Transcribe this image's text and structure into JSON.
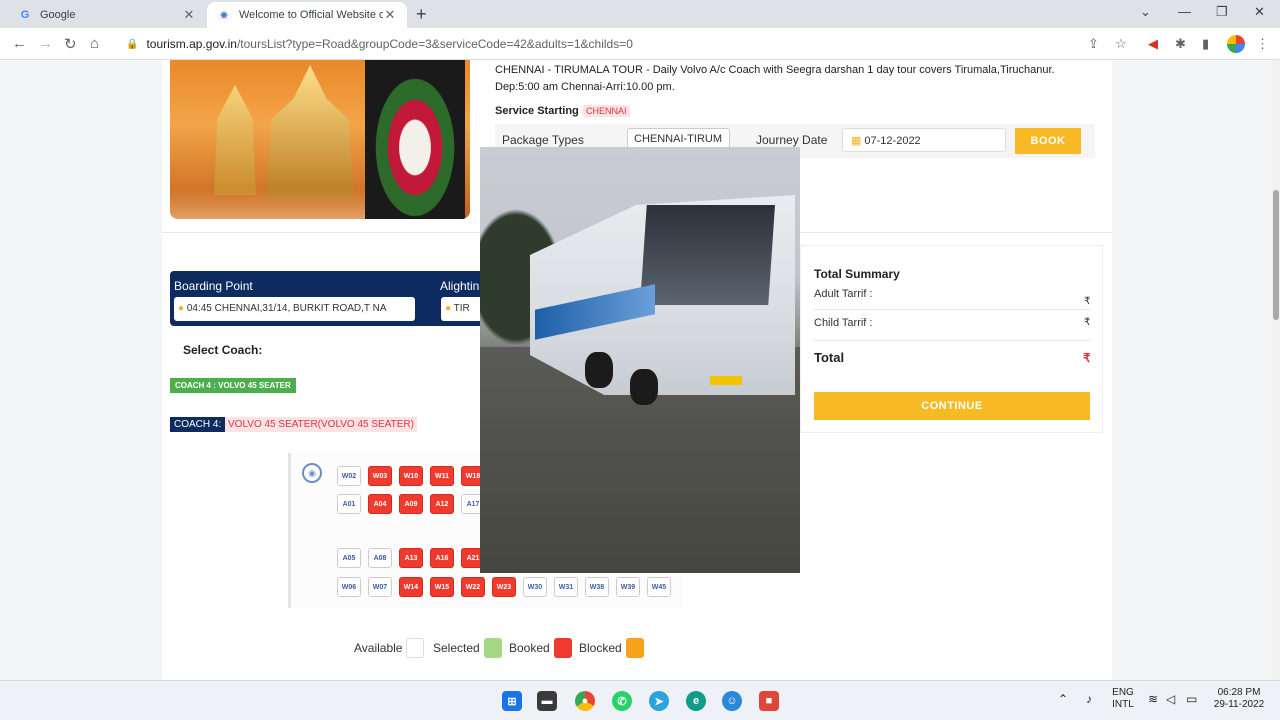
{
  "browser": {
    "tabs": [
      {
        "title": "Google",
        "icon": "google-g-icon"
      },
      {
        "title": "Welcome to Official Website of A",
        "icon": "ap-tourism-icon"
      }
    ],
    "url_host": "tourism.ap.gov.in",
    "url_path": "/toursList?type=Road&groupCode=3&serviceCode=42&adults=1&childs=0"
  },
  "tour": {
    "description": "CHENNAI - TIRUMALA TOUR - Daily Volvo A/c Coach with Seegra darshan 1 day tour covers Tirumala,Tiruchanur. Dep:5:00 am Chennai-Arri:10.00 pm.",
    "service_label": "Service Starting :",
    "service_value": "CHENNAI",
    "package_label": "Package Types",
    "package_value": "CHENNAI-TIRUM",
    "journey_label": "Journey Date",
    "journey_value": "07-12-2022",
    "book_label": "BOOK"
  },
  "boarding": {
    "boarding_label": "Boarding Point",
    "boarding_value": "04:45 CHENNAI,31/14, BURKIT ROAD,T NA",
    "alighting_label": "Alightin",
    "alighting_value": "TIR"
  },
  "coach": {
    "select_label": "Select Coach:",
    "chip": "COACH 4 : VOLVO 45 SEATER",
    "tag": "COACH 4:",
    "type": "VOLVO 45 SEATER(VOLVO 45 SEATER)"
  },
  "seats": {
    "row1": [
      {
        "id": "W02",
        "status": "available"
      },
      {
        "id": "W03",
        "status": "booked"
      },
      {
        "id": "W10",
        "status": "booked"
      },
      {
        "id": "W11",
        "status": "booked"
      },
      {
        "id": "W18",
        "status": "booked"
      }
    ],
    "row2": [
      {
        "id": "A01",
        "status": "available"
      },
      {
        "id": "A04",
        "status": "booked"
      },
      {
        "id": "A09",
        "status": "booked"
      },
      {
        "id": "A12",
        "status": "booked"
      },
      {
        "id": "A17",
        "status": "available"
      }
    ],
    "row3": [
      {
        "id": "A05",
        "status": "available"
      },
      {
        "id": "A08",
        "status": "available"
      },
      {
        "id": "A13",
        "status": "booked"
      },
      {
        "id": "A16",
        "status": "booked"
      },
      {
        "id": "A21",
        "status": "booked"
      }
    ],
    "row4": [
      {
        "id": "W06",
        "status": "available"
      },
      {
        "id": "W07",
        "status": "available"
      },
      {
        "id": "W14",
        "status": "booked"
      },
      {
        "id": "W15",
        "status": "booked"
      },
      {
        "id": "W22",
        "status": "booked"
      },
      {
        "id": "W23",
        "status": "booked"
      },
      {
        "id": "W30",
        "status": "available"
      },
      {
        "id": "W31",
        "status": "available"
      },
      {
        "id": "W38",
        "status": "available"
      },
      {
        "id": "W39",
        "status": "available"
      },
      {
        "id": "W45",
        "status": "available"
      }
    ]
  },
  "legend": {
    "available": "Available",
    "selected": "Selected",
    "booked": "Booked",
    "blocked": "Blocked",
    "colors": {
      "available": "#ffffff",
      "selected": "#a6d785",
      "booked": "#ef3b2d",
      "blocked": "#f7a21b"
    }
  },
  "summary": {
    "title": "Total Summary",
    "adult_label": "Adult Tarrif :",
    "adult_value": "₹",
    "child_label": "Child Tarrif :",
    "child_value": "₹",
    "total_label": "Total",
    "total_value": "₹",
    "continue_label": "CONTINUE"
  },
  "taskbar": {
    "lang_top": "ENG",
    "lang_bottom": "INTL",
    "time": "06:28 PM",
    "date": "29-11-2022",
    "edge_badge": "00"
  },
  "colors": {
    "accent": "#f7b924",
    "navy": "#0d2b5e",
    "danger": "#d9363e"
  }
}
